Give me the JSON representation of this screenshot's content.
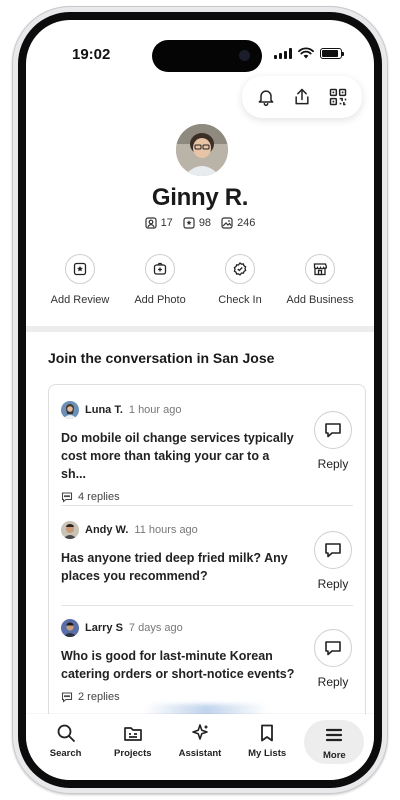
{
  "status": {
    "time": "19:02"
  },
  "profile": {
    "name": "Ginny R.",
    "stats": {
      "friends": "17",
      "reviews": "98",
      "photos": "246"
    }
  },
  "quick_actions": [
    {
      "label": "Add Review",
      "icon": "star-square-icon"
    },
    {
      "label": "Add Photo",
      "icon": "camera-plus-icon"
    },
    {
      "label": "Check In",
      "icon": "check-badge-icon"
    },
    {
      "label": "Add Business",
      "icon": "storefront-icon"
    }
  ],
  "section": {
    "title": "Join the conversation in San Jose"
  },
  "posts": [
    {
      "user": "Luna T.",
      "ago": "1 hour ago",
      "question": "Do mobile oil change services typically cost more than taking your car to a sh...",
      "replies": "4 replies",
      "reply_label": "Reply"
    },
    {
      "user": "Andy W.",
      "ago": "11 hours ago",
      "question": "Has anyone tried deep fried milk? Any places you recommend?",
      "replies": "",
      "reply_label": "Reply"
    },
    {
      "user": "Larry S",
      "ago": "7 days ago",
      "question": "Who is good for last-minute Korean catering orders or short-notice events?",
      "replies": "2 replies",
      "reply_label": "Reply"
    }
  ],
  "nav": [
    {
      "label": "Search",
      "icon": "search-icon"
    },
    {
      "label": "Projects",
      "icon": "projects-icon"
    },
    {
      "label": "Assistant",
      "icon": "sparkle-icon"
    },
    {
      "label": "My Lists",
      "icon": "bookmark-icon"
    },
    {
      "label": "More",
      "icon": "menu-icon",
      "active": true
    }
  ]
}
